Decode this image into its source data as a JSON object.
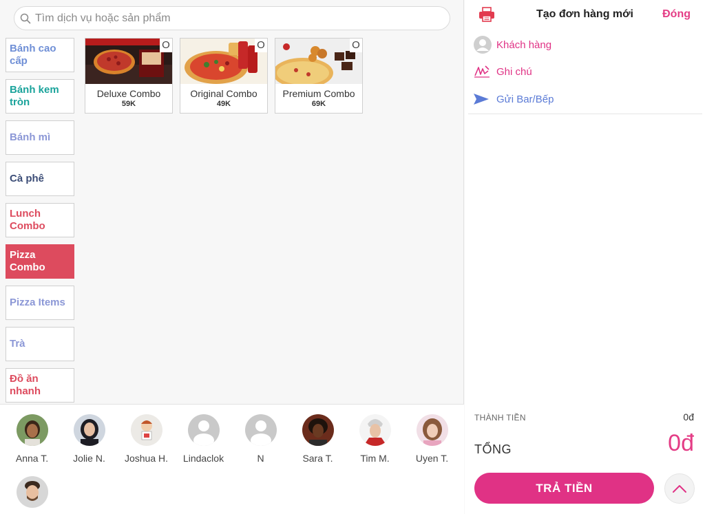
{
  "search": {
    "placeholder": "Tìm dịch vụ hoặc sản phẩm"
  },
  "categories": [
    {
      "label": "Bánh cao cấp",
      "color": "#6f8fd6"
    },
    {
      "label": "Bánh kem tròn",
      "color": "#1aa39b"
    },
    {
      "label": "Bánh mì",
      "color": "#8b97d6"
    },
    {
      "label": "Cà phê",
      "color": "#3c4d77"
    },
    {
      "label": "Lunch Combo",
      "color": "#dd4b5e"
    },
    {
      "label": "Pizza Combo",
      "color": "#ffffff",
      "active": true
    },
    {
      "label": "Pizza Items",
      "color": "#8b97d6"
    },
    {
      "label": "Trà",
      "color": "#8b97d6"
    },
    {
      "label": "Đồ ăn nhanh",
      "color": "#dd4b5e"
    }
  ],
  "products": [
    {
      "name": "Deluxe Combo",
      "price": "59K",
      "qty": "O"
    },
    {
      "name": "Original Combo",
      "price": "49K",
      "qty": "O"
    },
    {
      "name": "Premium Combo",
      "price": "69K",
      "qty": "O"
    }
  ],
  "staff": [
    {
      "name": "Anna T."
    },
    {
      "name": "Jolie N."
    },
    {
      "name": "Joshua H."
    },
    {
      "name": "Lindaclok"
    },
    {
      "name": "N"
    },
    {
      "name": "Sara T."
    },
    {
      "name": "Tim M."
    },
    {
      "name": "Uyen T."
    },
    {
      "name": ""
    }
  ],
  "order": {
    "title": "Tạo đơn hàng mới",
    "close_label": "Đóng",
    "customer_label": "Khách hàng",
    "note_label": "Ghi chú",
    "send_label": "Gửi Bar/Bếp",
    "subtotal_label": "THÀNH TIỀN",
    "subtotal_value": "0đ",
    "total_label": "TỔNG",
    "total_value": "0đ",
    "pay_label": "TRẢ TIỀN"
  },
  "colors": {
    "accent": "#e03285",
    "active_category": "#dd4b5e",
    "send": "#5b7bd6"
  }
}
